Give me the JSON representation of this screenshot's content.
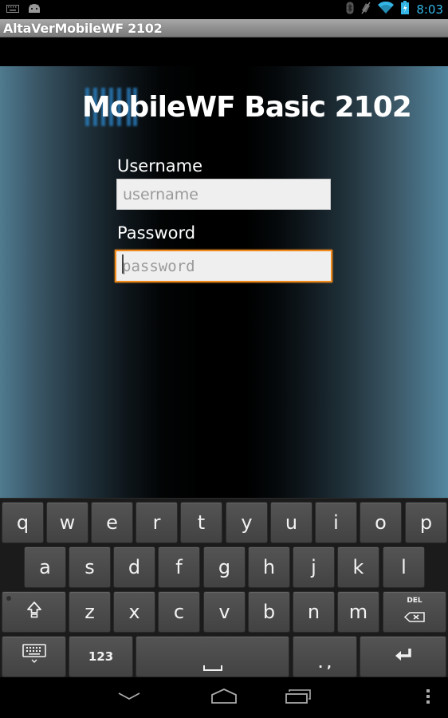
{
  "status_bar": {
    "left_icons": [
      "keyboard-icon",
      "android-icon"
    ],
    "right_icons": [
      "bluetooth-icon",
      "vibrate-off-icon",
      "wifi-icon",
      "battery-charging-icon"
    ],
    "time": "8:03",
    "accent_color": "#33b5e5"
  },
  "window": {
    "title": "AltaVerMobileWF 2102"
  },
  "login": {
    "app_title": "MobileWF Basic 2102",
    "username_label": "Username",
    "username_value": "",
    "username_placeholder": "username",
    "password_label": "Password",
    "password_value": "",
    "password_placeholder": "password",
    "focused_field": "password",
    "focus_color": "#f08a1c"
  },
  "keyboard": {
    "row1": [
      "q",
      "w",
      "e",
      "r",
      "t",
      "y",
      "u",
      "i",
      "o",
      "p"
    ],
    "row2": [
      "a",
      "s",
      "d",
      "f",
      "g",
      "h",
      "j",
      "k",
      "l"
    ],
    "row3": [
      "z",
      "x",
      "c",
      "v",
      "b",
      "n",
      "m"
    ],
    "shift_icon": "shift-icon",
    "delete_label": "DEL",
    "keyboard_settings_icon": "keyboard-hide-icon",
    "symbols_label": "123",
    "space_label": "␣",
    "punct_label": ". ,",
    "enter_icon": "enter-icon"
  },
  "nav_bar": {
    "buttons": [
      "back-icon",
      "home-icon",
      "recent-apps-icon",
      "menu-icon"
    ]
  }
}
